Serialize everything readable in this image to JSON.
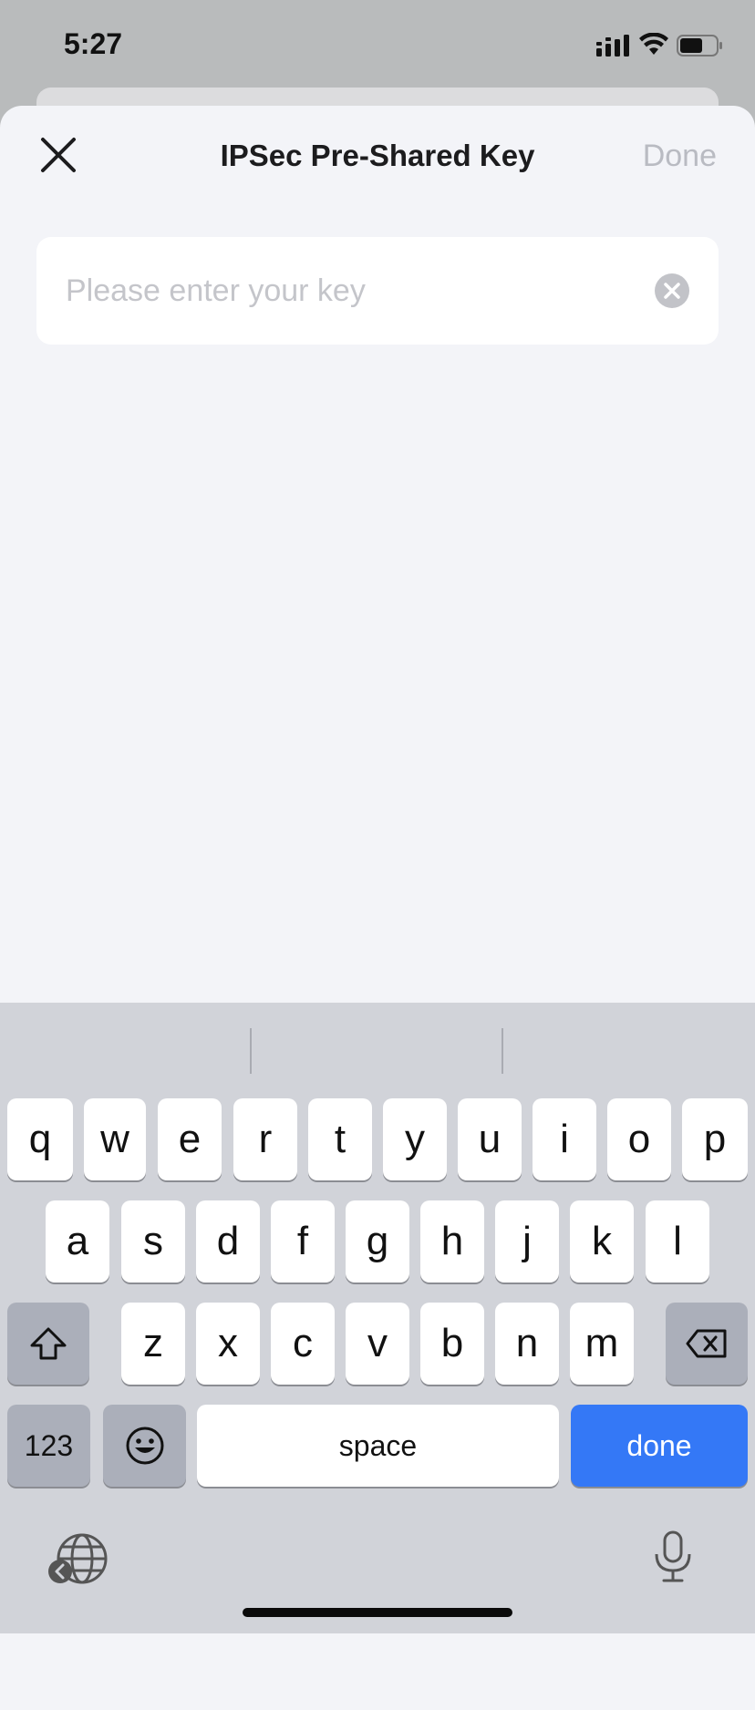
{
  "status_bar": {
    "time": "5:27"
  },
  "sheet": {
    "title": "IPSec Pre-Shared Key",
    "done_label": "Done",
    "key_input": {
      "value": "",
      "placeholder": "Please enter your key"
    }
  },
  "keyboard": {
    "row1": [
      "q",
      "w",
      "e",
      "r",
      "t",
      "y",
      "u",
      "i",
      "o",
      "p"
    ],
    "row2": [
      "a",
      "s",
      "d",
      "f",
      "g",
      "h",
      "j",
      "k",
      "l"
    ],
    "row3": [
      "z",
      "x",
      "c",
      "v",
      "b",
      "n",
      "m"
    ],
    "numbers_label": "123",
    "space_label": "space",
    "done_label": "done"
  },
  "colors": {
    "accent": "#3478f6",
    "sheet_bg": "#f3f4f8",
    "keyboard_bg": "#d1d3d9"
  }
}
